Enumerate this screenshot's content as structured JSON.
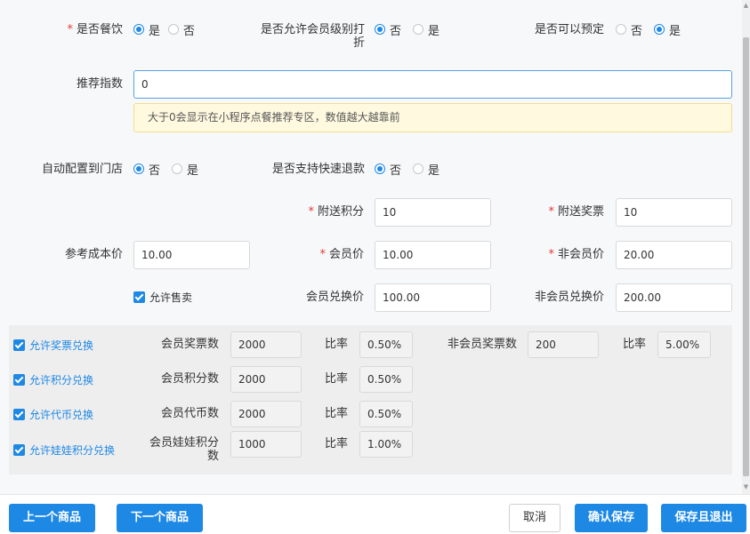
{
  "row1": {
    "dining": {
      "label": "是否餐饮",
      "opt1": "是",
      "opt2": "否",
      "selected": "是"
    },
    "member_discount": {
      "label": "是否允许会员级别打折",
      "opt1": "否",
      "opt2": "是",
      "selected": "否"
    },
    "reservable": {
      "label": "是否可以预定",
      "opt1": "否",
      "opt2": "是",
      "selected": "是"
    }
  },
  "recommend": {
    "label": "推荐指数",
    "value": "0",
    "tip": "大于0会显示在小程序点餐推荐专区，数值越大越靠前"
  },
  "row3": {
    "auto_store": {
      "label": "自动配置到门店",
      "opt1": "否",
      "opt2": "是",
      "selected": "否"
    },
    "quick_refund": {
      "label": "是否支持快速退款",
      "opt1": "否",
      "opt2": "是",
      "selected": "否"
    }
  },
  "fields": {
    "bonus_points": {
      "label": "附送积分",
      "value": "10"
    },
    "bonus_tickets": {
      "label": "附送奖票",
      "value": "10"
    },
    "cost_price": {
      "label": "参考成本价",
      "value": "10.00"
    },
    "member_price": {
      "label": "会员价",
      "value": "10.00"
    },
    "nonmember_price": {
      "label": "非会员价",
      "value": "20.00"
    },
    "allow_sale": {
      "label": "允许售卖"
    },
    "member_exchange": {
      "label": "会员兑换价",
      "value": "100.00"
    },
    "nonmember_exchange": {
      "label": "非会员兑换价",
      "value": "200.00"
    }
  },
  "exchange": {
    "ticket": {
      "check": "允许奖票兑换",
      "label": "会员奖票数",
      "value": "2000",
      "ratio_label": "比率",
      "ratio": "0.50%",
      "nm_label": "非会员奖票数",
      "nm_value": "200",
      "nm_ratio_label": "比率",
      "nm_ratio": "5.00%"
    },
    "points": {
      "check": "允许积分兑换",
      "label": "会员积分数",
      "value": "2000",
      "ratio_label": "比率",
      "ratio": "0.50%"
    },
    "tokens": {
      "check": "允许代币兑换",
      "label": "会员代币数",
      "value": "2000",
      "ratio_label": "比率",
      "ratio": "0.50%"
    },
    "doll": {
      "check": "允许娃娃积分兑换",
      "label1": "会员娃娃积分",
      "label2": "数",
      "value": "1000",
      "ratio_label": "比率",
      "ratio": "1.00%"
    }
  },
  "footer": {
    "prev": "上一个商品",
    "next": "下一个商品",
    "cancel": "取消",
    "confirm": "确认保存",
    "save_exit": "保存且退出"
  },
  "colors": {
    "accent": "#1e88e5",
    "required": "#e53935"
  }
}
